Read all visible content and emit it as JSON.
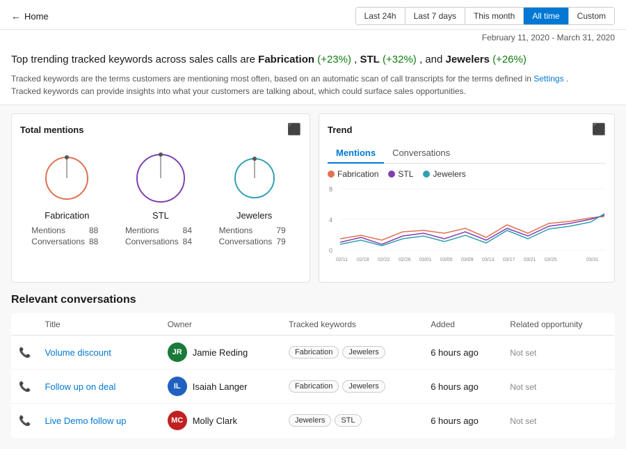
{
  "topbar": {
    "back_label": "Home"
  },
  "time_filters": [
    {
      "label": "Last 24h",
      "active": false
    },
    {
      "label": "Last 7 days",
      "active": false
    },
    {
      "label": "This month",
      "active": false
    },
    {
      "label": "All time",
      "active": true
    },
    {
      "label": "Custom",
      "active": false
    }
  ],
  "date_range": "February 11, 2020 - March 31, 2020",
  "headline": {
    "text_prefix": "Top trending tracked keywords across sales calls are ",
    "k1": "Fabrication",
    "k1_change": "(+23%)",
    "k2": "STL",
    "k2_change": "(+32%)",
    "k3": "Jewelers",
    "k3_change": "(+26%)"
  },
  "description": {
    "line1": "Tracked keywords are the terms customers are mentioning most often, based on an automatic scan of call transcripts for the terms defined in ",
    "settings_link": "Settings",
    "line2": ".",
    "line3": "Tracked keywords can provide insights into what your customers are talking about, which could surface sales opportunities."
  },
  "total_mentions": {
    "title": "Total mentions",
    "items": [
      {
        "name": "Fabrication",
        "mentions": 88,
        "conversations": 88,
        "color": "#e07050",
        "radius": 30
      },
      {
        "name": "STL",
        "mentions": 84,
        "conversations": 84,
        "color": "#8040b0",
        "radius": 34
      },
      {
        "name": "Jewelers",
        "mentions": 79,
        "conversations": 79,
        "color": "#30a0b0",
        "radius": 28
      }
    ],
    "mentions_label": "Mentions",
    "conversations_label": "Conversations"
  },
  "trend": {
    "title": "Trend",
    "tabs": [
      "Mentions",
      "Conversations"
    ],
    "active_tab": "Mentions",
    "legend": [
      {
        "label": "Fabrication",
        "color": "#e07050"
      },
      {
        "label": "STL",
        "color": "#8040b0"
      },
      {
        "label": "Jewelers",
        "color": "#30a0b0"
      }
    ],
    "y_labels": [
      "8",
      "4",
      "0"
    ],
    "x_labels": [
      "02/11",
      "02/18",
      "02/22",
      "02/26",
      "03/01",
      "03/05",
      "03/09",
      "03/13",
      "03/17",
      "03/21",
      "03/25",
      "03/31"
    ]
  },
  "conversations": {
    "title": "Relevant conversations",
    "columns": [
      "Title",
      "Owner",
      "Tracked keywords",
      "Added",
      "Related opportunity"
    ],
    "rows": [
      {
        "title": "Volume discount",
        "owner_name": "Jamie Reding",
        "owner_initials": "JR",
        "owner_color": "#1a7a3a",
        "keywords": [
          "Fabrication",
          "Jewelers"
        ],
        "added": "6 hours ago",
        "opportunity": "Not set"
      },
      {
        "title": "Follow up on deal",
        "owner_name": "Isaiah Langer",
        "owner_initials": "IL",
        "owner_color": "#2060c0",
        "keywords": [
          "Fabrication",
          "Jewelers"
        ],
        "added": "6 hours ago",
        "opportunity": "Not set"
      },
      {
        "title": "Live Demo follow up",
        "owner_name": "Molly Clark",
        "owner_initials": "MC",
        "owner_color": "#c02020",
        "keywords": [
          "Jewelers",
          "STL"
        ],
        "added": "6 hours ago",
        "opportunity": "Not set"
      }
    ]
  }
}
